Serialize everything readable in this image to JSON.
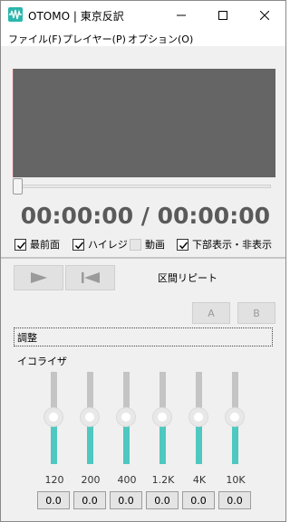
{
  "window": {
    "title": "OTOMO | 東京反訳",
    "app_icon": "waveform-icon",
    "accent": "#2ab6ad"
  },
  "menu": [
    "ファイル(F)",
    "プレイヤー(P)",
    "オプション(O)"
  ],
  "player": {
    "time_display": "00:00:00 / 00:00:00",
    "seek_position": 0,
    "options": [
      {
        "label": "最前面",
        "checked": true,
        "enabled": true
      },
      {
        "label": "ハイレジ",
        "checked": true,
        "enabled": true
      },
      {
        "label": "動画",
        "checked": false,
        "enabled": false
      },
      {
        "label": "下部表示・非表示",
        "checked": true,
        "enabled": true
      }
    ]
  },
  "controls": {
    "play_icon": "play-icon",
    "rewind_icon": "skip-to-start-icon",
    "repeat_label": "区間リピート",
    "a_label": "A",
    "b_label": "B"
  },
  "adjust": {
    "label": "調整"
  },
  "equalizer": {
    "label": "イコライザ",
    "bands": [
      {
        "freq": "120",
        "gain": "0.0"
      },
      {
        "freq": "200",
        "gain": "0.0"
      },
      {
        "freq": "400",
        "gain": "0.0"
      },
      {
        "freq": "1.2K",
        "gain": "0.0"
      },
      {
        "freq": "4K",
        "gain": "0.0"
      },
      {
        "freq": "10K",
        "gain": "0.0"
      }
    ]
  }
}
